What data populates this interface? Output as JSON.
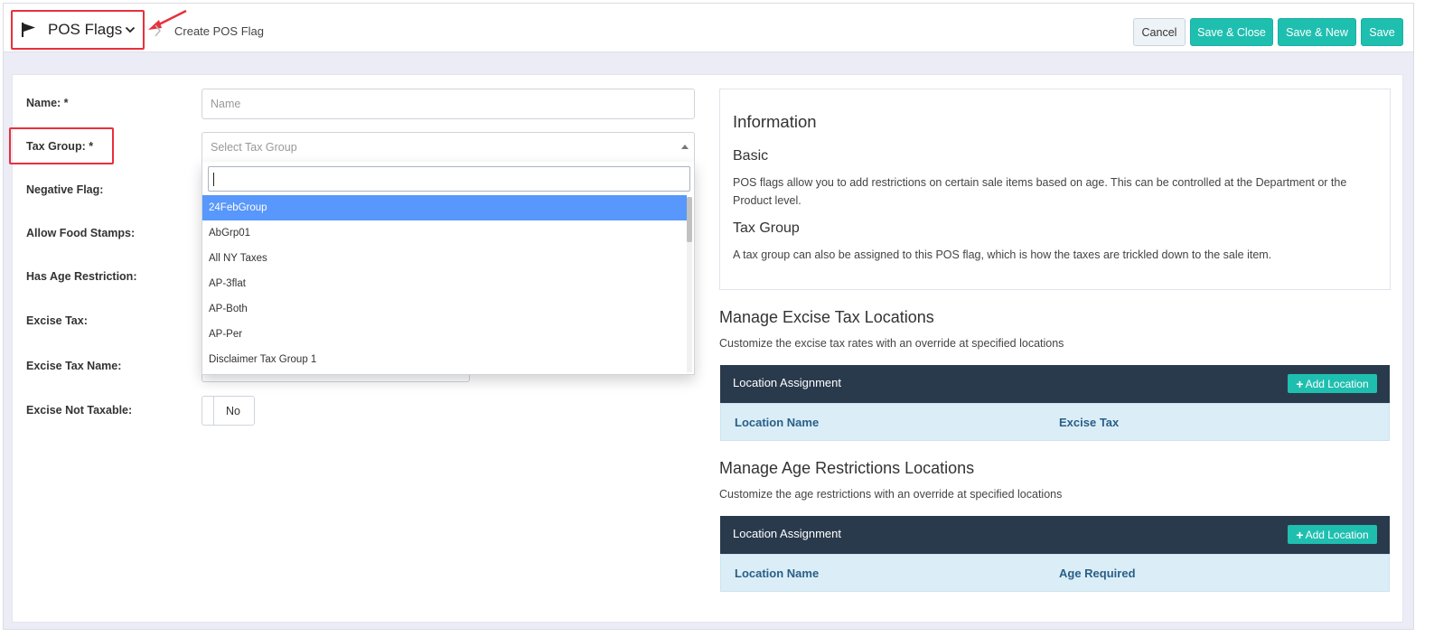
{
  "header": {
    "module_label": "POS Flags",
    "breadcrumb": "Create POS Flag",
    "buttons": {
      "cancel": "Cancel",
      "save_close": "Save & Close",
      "save_new": "Save & New",
      "save": "Save"
    }
  },
  "form": {
    "name_label": "Name: *",
    "name_placeholder": "Name",
    "tax_group_label": "Tax Group: *",
    "tax_group_placeholder": "Select Tax Group",
    "negative_flag_label": "Negative Flag:",
    "allow_food_stamps_label": "Allow Food Stamps:",
    "has_age_restriction_label": "Has Age Restriction:",
    "excise_tax_label": "Excise Tax:",
    "excise_tax_name_label": "Excise Tax Name:",
    "excise_not_taxable_label": "Excise Not Taxable:",
    "excise_not_taxable_value": "No",
    "tax_group_options": [
      "24FebGroup",
      "AbGrp01",
      "All NY Taxes",
      "AP-3flat",
      "AP-Both",
      "AP-Per",
      "Disclaimer Tax Group 1"
    ],
    "tax_group_highlighted": "24FebGroup"
  },
  "info": {
    "title": "Information",
    "basic_title": "Basic",
    "basic_text": "POS flags allow you to add restrictions on certain sale items based on age. This can be controlled at the Department or the Product level.",
    "tax_group_title": "Tax Group",
    "tax_group_text": "A tax group can also be assigned to this POS flag, which is how the taxes are trickled down to the sale item."
  },
  "excise_section": {
    "title": "Manage Excise Tax Locations",
    "desc": "Customize the excise tax rates with an override at specified locations",
    "table_title": "Location Assignment",
    "add_label": "Add Location",
    "col1": "Location Name",
    "col2": "Excise Tax"
  },
  "age_section": {
    "title": "Manage Age Restrictions Locations",
    "desc": "Customize the age restrictions with an override at specified locations",
    "table_title": "Location Assignment",
    "add_label": "Add Location",
    "col1": "Location Name",
    "col2": "Age Required"
  },
  "colors": {
    "accent_teal": "#1fbfb0",
    "highlight_red": "#e8303c",
    "table_header": "#2a3a4d",
    "option_selected": "#5897fb"
  }
}
